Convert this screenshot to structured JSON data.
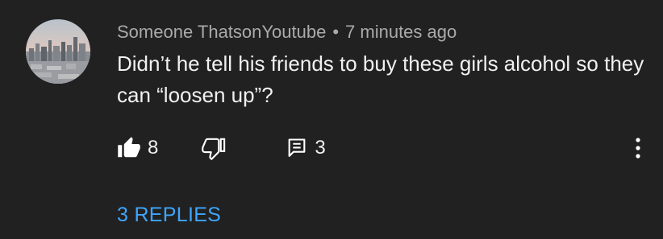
{
  "comment": {
    "author": "Someone ThatsonYoutube",
    "separator": "•",
    "time": "7 minutes ago",
    "text": "Didn’t he tell his friends to buy these girls alcohol so they can “loosen up”?",
    "avatar_icon": "city-skyline-avatar"
  },
  "actions": {
    "like_icon": "thumbs-up-icon",
    "like_count": "8",
    "dislike_icon": "thumbs-down-icon",
    "reply_icon": "comment-icon",
    "reply_count": "3",
    "more_icon": "more-vertical-icon"
  },
  "replies": {
    "label": "3 REPLIES"
  },
  "colors": {
    "background": "#212121",
    "text_primary": "#f1f1f1",
    "text_secondary": "#aaaaaa",
    "link": "#3ea6ff"
  }
}
